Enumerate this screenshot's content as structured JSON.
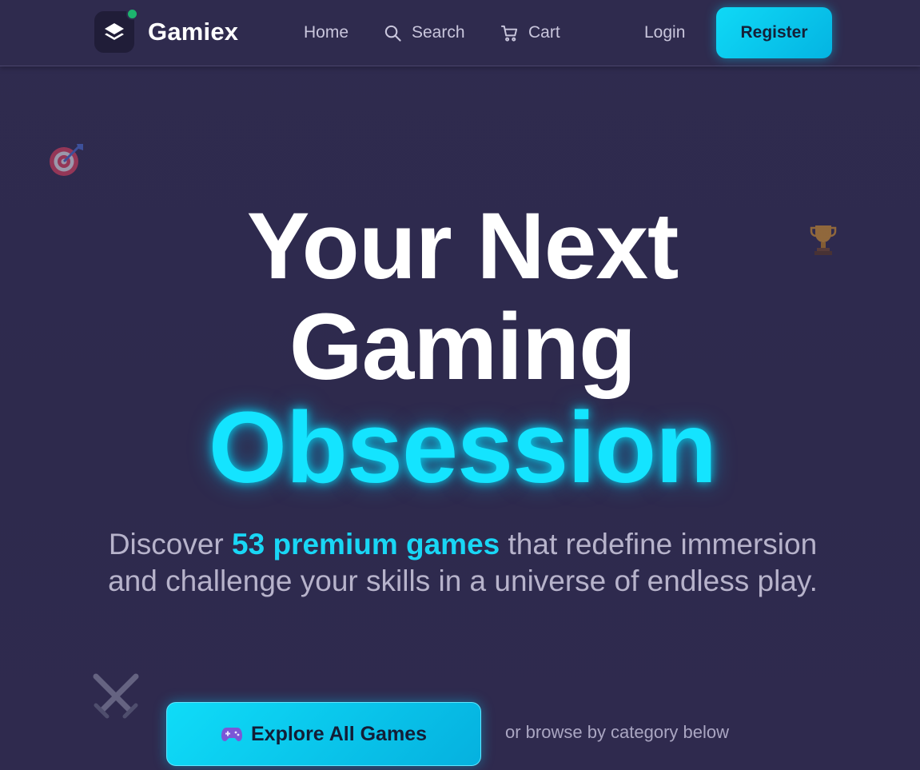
{
  "header": {
    "brand": "Gamiex",
    "nav": {
      "home": "Home",
      "search": "Search",
      "cart": "Cart",
      "login": "Login",
      "register": "Register"
    }
  },
  "hero": {
    "line1": "Your Next",
    "line2": "Gaming",
    "line3": "Obsession",
    "subtitle_pre": "Discover ",
    "subtitle_highlight": "53 premium games",
    "subtitle_post": " that redefine immersion and challenge your skills in a universe of endless play.",
    "explore_button": "Explore All Games",
    "browse_hint": "or browse by category below"
  },
  "icons": {
    "logo": "layers-icon",
    "search": "search-icon",
    "cart": "cart-icon",
    "explore": "gamepad-icon",
    "decor": [
      "target-icon",
      "trophy-icon",
      "crossed-swords-icon"
    ]
  },
  "colors": {
    "background": "#2e2a4d",
    "accent": "#14e4ff",
    "online_dot": "#1db36e"
  }
}
